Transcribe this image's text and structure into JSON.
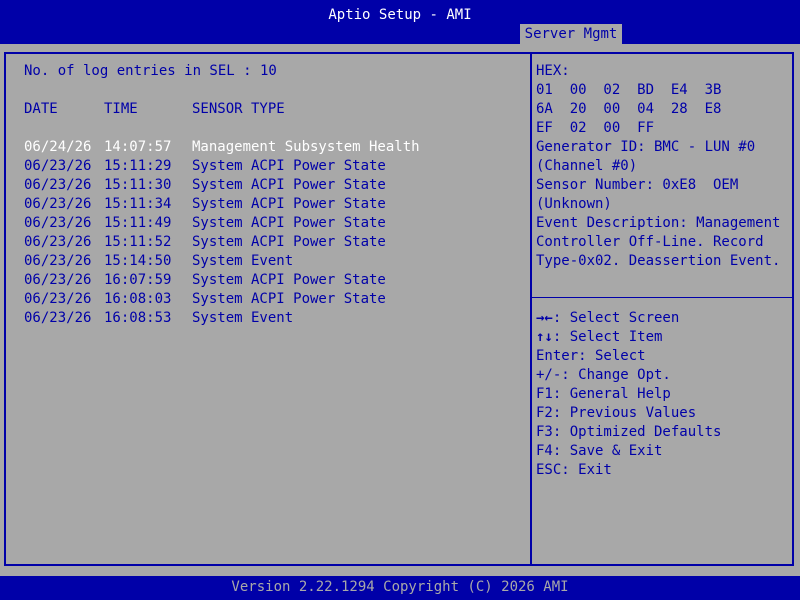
{
  "header": {
    "title": "Aptio Setup - AMI",
    "active_tab": "Server Mgmt"
  },
  "sel": {
    "entries_label": "No. of log entries in SEL : 10",
    "columns": {
      "date": "DATE",
      "time": "TIME",
      "sensor_type": "SENSOR TYPE"
    },
    "rows": [
      {
        "date": "06/24/26",
        "time": "14:07:57",
        "sensor_type": "Management Subsystem Health"
      },
      {
        "date": "06/23/26",
        "time": "15:11:29",
        "sensor_type": "System ACPI Power State"
      },
      {
        "date": "06/23/26",
        "time": "15:11:30",
        "sensor_type": "System ACPI Power State"
      },
      {
        "date": "06/23/26",
        "time": "15:11:34",
        "sensor_type": "System ACPI Power State"
      },
      {
        "date": "06/23/26",
        "time": "15:11:49",
        "sensor_type": "System ACPI Power State"
      },
      {
        "date": "06/23/26",
        "time": "15:11:52",
        "sensor_type": "System ACPI Power State"
      },
      {
        "date": "06/23/26",
        "time": "15:14:50",
        "sensor_type": "System Event"
      },
      {
        "date": "06/23/26",
        "time": "16:07:59",
        "sensor_type": "System ACPI Power State"
      },
      {
        "date": "06/23/26",
        "time": "16:08:03",
        "sensor_type": "System ACPI Power State"
      },
      {
        "date": "06/23/26",
        "time": "16:08:53",
        "sensor_type": "System Event"
      }
    ]
  },
  "details": {
    "lines": [
      "HEX:",
      "01  00  02  BD  E4  3B",
      "6A  20  00  04  28  E8",
      "EF  02  00  FF",
      "Generator ID: BMC - LUN #0",
      "(Channel #0)",
      "Sensor Number: 0xE8  OEM",
      "(Unknown)",
      "Event Description: Management",
      "Controller Off-Line. Record",
      "Type-0x02. Deassertion Event."
    ]
  },
  "help": {
    "items": [
      {
        "key": "→←",
        "text": ": Select Screen"
      },
      {
        "key": "↑↓",
        "text": ": Select Item"
      },
      {
        "key": "",
        "text": "Enter: Select"
      },
      {
        "key": "",
        "text": "+/-: Change Opt."
      },
      {
        "key": "",
        "text": "F1: General Help"
      },
      {
        "key": "",
        "text": "F2: Previous Values"
      },
      {
        "key": "",
        "text": "F3: Optimized Defaults"
      },
      {
        "key": "",
        "text": "F4: Save & Exit"
      },
      {
        "key": "",
        "text": "ESC: Exit"
      }
    ]
  },
  "footer": {
    "version": "Version 2.22.1294 Copyright (C) 2026 AMI"
  },
  "colors": {
    "bios_blue": "#0000a8",
    "bios_gray": "#a8a8a8",
    "selected_white": "#ffffff"
  }
}
